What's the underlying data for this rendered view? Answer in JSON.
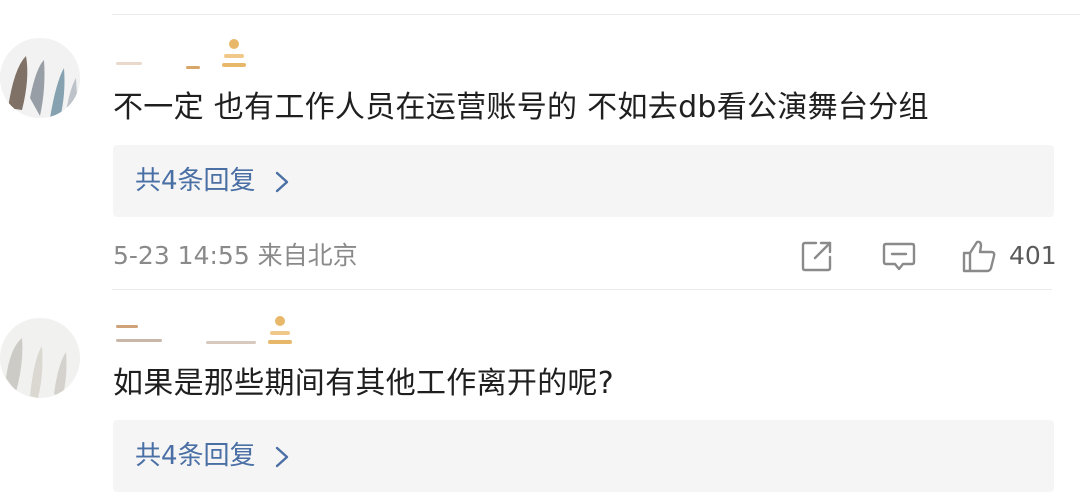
{
  "comments": [
    {
      "text": "不一定 也有工作人员在运营账号的 不如去db看公演舞台分组",
      "replies_label": "共4条回复",
      "timestamp": "5-23 14:55 来自北京",
      "likes": "401"
    },
    {
      "text": "如果是那些期间有其他工作离开的呢?",
      "replies_label": "共4条回复"
    }
  ],
  "icons": {
    "vip_badge": "vip-crown-badge-icon",
    "chevron": "chevron-right-icon",
    "share": "share-edit-icon",
    "comment": "comment-bubble-icon",
    "like": "thumbs-up-icon"
  },
  "colors": {
    "reply_link": "#4a6fa5",
    "reply_bg": "#f5f5f5",
    "meta_gray": "#8a8a8a",
    "badge_gold": "#e8b86a"
  }
}
